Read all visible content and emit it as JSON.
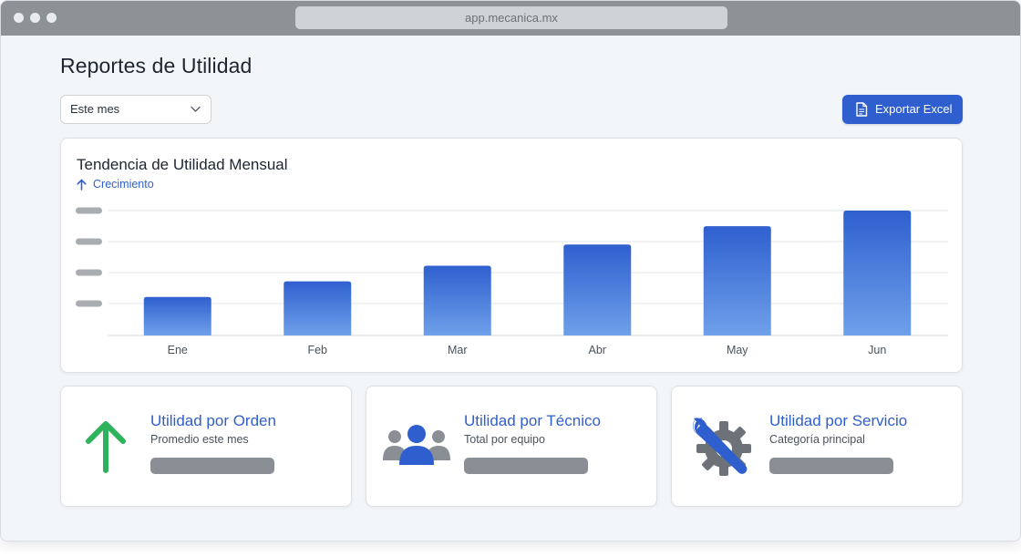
{
  "browser": {
    "url": "app.mecanica.mx"
  },
  "page": {
    "title": "Reportes de Utilidad"
  },
  "filter": {
    "selected": "Este mes"
  },
  "toolbar": {
    "export_label": "Exportar Excel"
  },
  "chart": {
    "title": "Tendencia de Utilidad Mensual",
    "trend_label": "Crecimiento"
  },
  "chart_data": {
    "type": "bar",
    "title": "Tendencia de Utilidad Mensual",
    "categories": [
      "Ene",
      "Feb",
      "Mar",
      "Abr",
      "May",
      "Jun"
    ],
    "values": [
      42,
      59,
      76,
      99,
      119,
      136
    ],
    "ylim": [
      0,
      136
    ],
    "grid": true,
    "y_tick_labels_visible": false,
    "colors": {
      "bar_top": "#2f60cf",
      "bar_bottom": "#6fa0ea"
    }
  },
  "cards": [
    {
      "title": "Utilidad por Orden",
      "subtitle": "Promedio este mes",
      "icon": "arrow-up-icon"
    },
    {
      "title": "Utilidad por Técnico",
      "subtitle": "Total por equipo",
      "icon": "team-icon"
    },
    {
      "title": "Utilidad por Servicio",
      "subtitle": "Categoría principal",
      "icon": "wrench-gear-icon"
    }
  ],
  "colors": {
    "accent": "#2f5fce",
    "green": "#2fb35a",
    "gray": "#8a8f95"
  }
}
